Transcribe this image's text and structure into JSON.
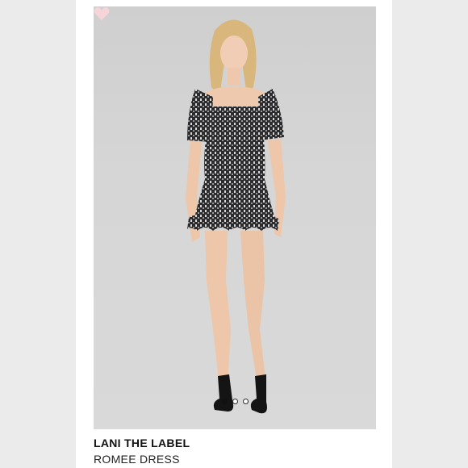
{
  "listing": {
    "brand": "LANI THE LABEL",
    "product_name": "ROMEE DRESS"
  },
  "carousel": {
    "total_images": 3,
    "active_index": 0
  },
  "icons": {
    "favorite": "heart-icon"
  },
  "colors": {
    "background": "#ececec",
    "card": "#ffffff",
    "photo_backdrop": "#d3d3d3",
    "heart": "#f6d4d8"
  }
}
